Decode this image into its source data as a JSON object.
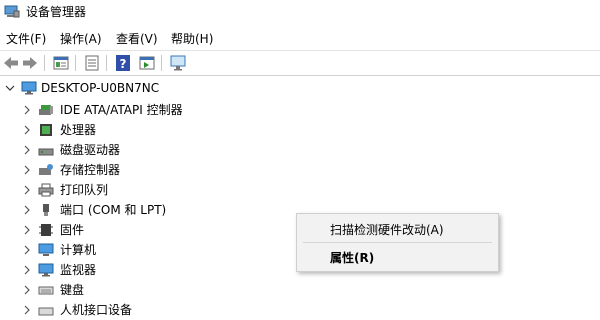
{
  "window": {
    "title": "设备管理器"
  },
  "menu": {
    "items": [
      "文件(F)",
      "操作(A)",
      "查看(V)",
      "帮助(H)"
    ]
  },
  "toolbar": {
    "buttons": [
      "back-icon",
      "forward-icon",
      "properties-view-icon",
      "list-view-icon",
      "help-icon",
      "run-icon",
      "monitor-scan-icon"
    ]
  },
  "tree": {
    "root": "DESKTOP-U0BN7NC",
    "items": [
      {
        "label": "IDE ATA/ATAPI 控制器",
        "icon": "ide-controller-icon"
      },
      {
        "label": "处理器",
        "icon": "processor-icon"
      },
      {
        "label": "磁盘驱动器",
        "icon": "disk-drive-icon"
      },
      {
        "label": "存储控制器",
        "icon": "storage-controller-icon"
      },
      {
        "label": "打印队列",
        "icon": "printer-icon"
      },
      {
        "label": "端口 (COM 和 LPT)",
        "icon": "port-icon"
      },
      {
        "label": "固件",
        "icon": "firmware-icon"
      },
      {
        "label": "计算机",
        "icon": "computer-icon"
      },
      {
        "label": "监视器",
        "icon": "monitor-icon"
      },
      {
        "label": "键盘",
        "icon": "keyboard-icon"
      },
      {
        "label": "人机接口设备",
        "icon": "hid-icon"
      }
    ]
  },
  "context_menu": {
    "scan": "扫描检测硬件改动(A)",
    "properties": "属性(R)"
  }
}
